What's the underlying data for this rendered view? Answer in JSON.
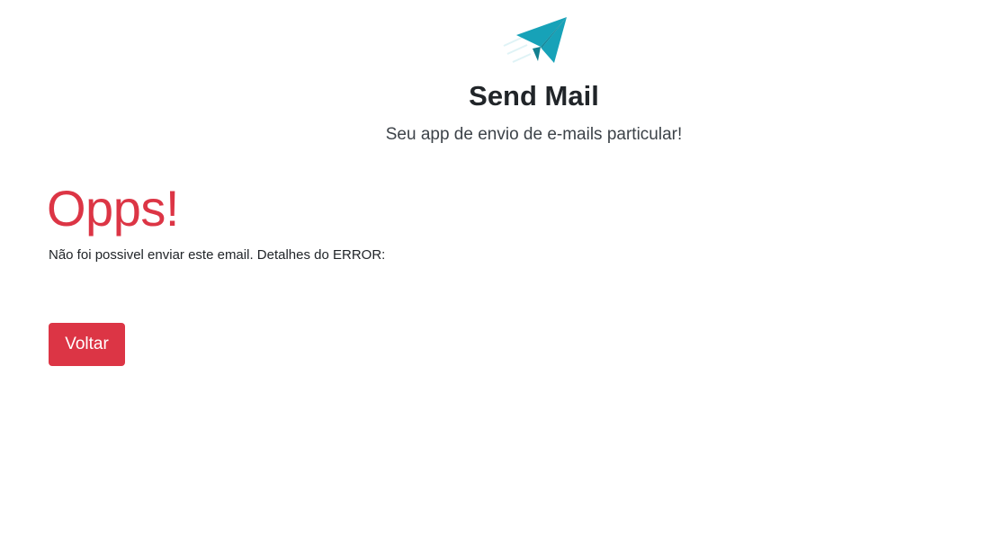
{
  "header": {
    "logo_icon": "paper-plane-icon",
    "title": "Send Mail",
    "subtitle": "Seu app de envio de e-mails particular!"
  },
  "error": {
    "heading": "Opps!",
    "message": "Não foi possivel enviar este email. Detalhes do ERROR:"
  },
  "actions": {
    "back_label": "Voltar"
  },
  "colors": {
    "accent_danger": "#dc3545",
    "logo": "#17a2b8",
    "text": "#212529"
  }
}
